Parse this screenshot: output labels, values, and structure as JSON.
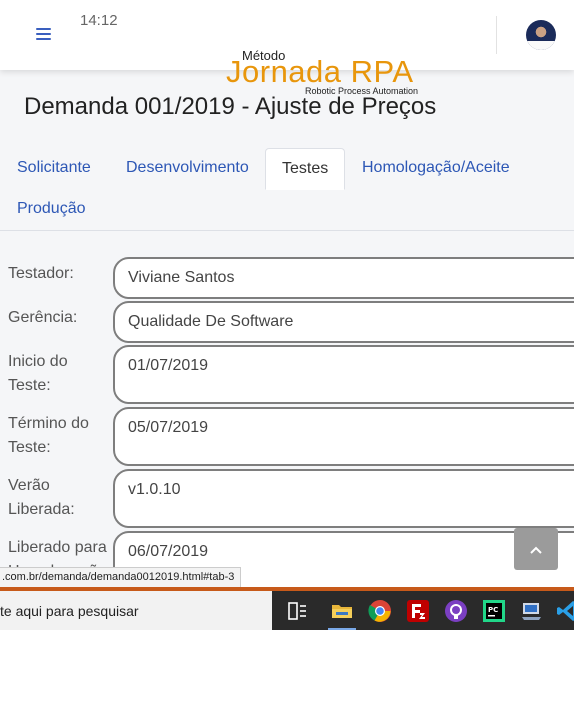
{
  "header": {
    "time": "14:12",
    "logo": {
      "small": "Método",
      "brand": "Jornada RPA",
      "tagline": "Robotic Process Automation"
    }
  },
  "page": {
    "title": "Demanda 001/2019 - Ajuste de Preços"
  },
  "tabs": [
    {
      "label": "Solicitante"
    },
    {
      "label": "Desenvolvimento"
    },
    {
      "label": "Testes"
    },
    {
      "label": "Homologação/Aceite"
    },
    {
      "label": "Produção"
    }
  ],
  "fields": [
    {
      "label": "Testador:",
      "value": "Viviane Santos"
    },
    {
      "label": "Gerência:",
      "value": "Qualidade De Software"
    },
    {
      "label": "Inicio do Teste:",
      "value": "01/07/2019"
    },
    {
      "label": "Término do Teste:",
      "value": "05/07/2019"
    },
    {
      "label": "Verão Liberada:",
      "value": "v1.0.10"
    },
    {
      "label": "Liberado para Homologação:",
      "value": "06/07/2019"
    }
  ],
  "status_url": ".com.br/demanda/demanda0012019.html#tab-3",
  "taskbar": {
    "search_placeholder": "te aqui para pesquisar",
    "apps": [
      "task-view-icon",
      "file-explorer-icon",
      "chrome-icon",
      "filezilla-icon",
      "github-desktop-icon",
      "pycharm-icon",
      "remote-desktop-icon",
      "vscode-icon"
    ]
  },
  "colors": {
    "brand": "#e8960c",
    "link": "#2d57b5",
    "taskbar": "#2a2a2a",
    "accent_line": "#c75a1a"
  }
}
